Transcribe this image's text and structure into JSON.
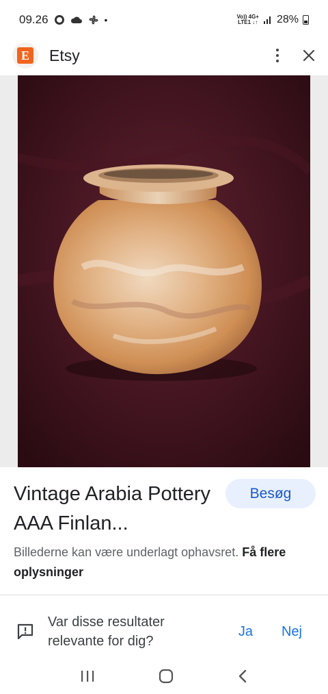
{
  "status": {
    "time": "09.26",
    "network_top": "Vo)) 4G+",
    "network_bottom": "LTE1 ↓↑",
    "battery": "28%"
  },
  "app_bar": {
    "logo_letter": "E",
    "title": "Etsy"
  },
  "result": {
    "title": "Vintage Arabia Pottery AAA Finlan...",
    "visit_label": "Besøg",
    "copyright_text": "Billederne kan være underlagt ophavsret.",
    "more_info_link": "Få flere oplysninger"
  },
  "feedback": {
    "question": "Var disse resultater relevante for dig?",
    "yes_label": "Ja",
    "no_label": "Nej"
  },
  "colors": {
    "accent": "#1a73e8",
    "etsy_orange": "#f1641e",
    "visit_button_bg": "#e8f0fe"
  },
  "icons": [
    "whatsapp-icon",
    "cloud-icon",
    "fan-icon",
    "signal-icon",
    "battery-icon",
    "more-vert-icon",
    "close-icon",
    "feedback-icon",
    "recent-apps-icon",
    "home-icon",
    "back-icon"
  ]
}
